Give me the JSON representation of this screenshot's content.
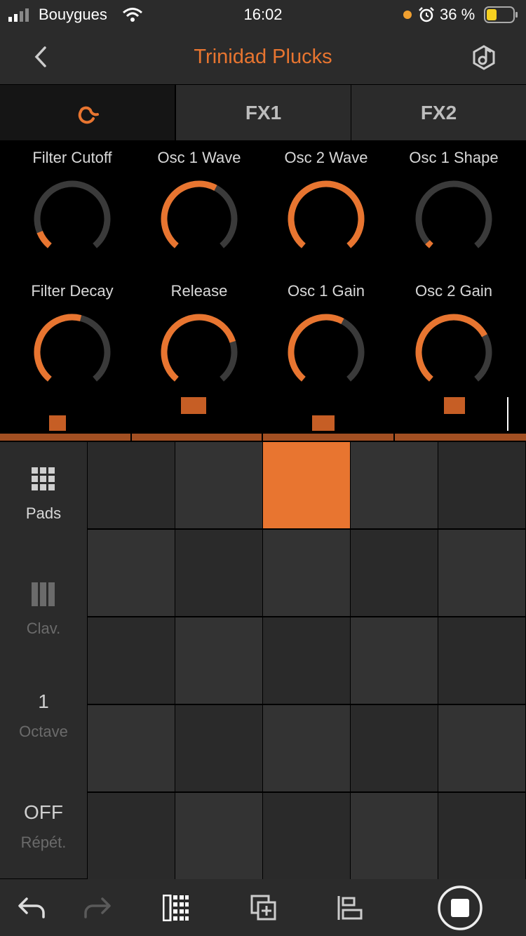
{
  "status_bar": {
    "carrier": "Bouygues",
    "time": "16:02",
    "battery": "36 %"
  },
  "header": {
    "title": "Trinidad Plucks",
    "back_icon": "chevron-left-icon",
    "action_icon": "browser-icon"
  },
  "tabs": [
    {
      "label": "",
      "icon": "wave-icon",
      "active": true
    },
    {
      "label": "FX1",
      "active": false
    },
    {
      "label": "FX2",
      "active": false
    }
  ],
  "knobs": [
    {
      "label": "Filter Cutoff",
      "value": 0.1
    },
    {
      "label": "Osc 1 Wave",
      "value": 0.6
    },
    {
      "label": "Osc 2 Wave",
      "value": 1.0
    },
    {
      "label": "Osc 1 Shape",
      "value": 0.03
    },
    {
      "label": "Filter Decay",
      "value": 0.55
    },
    {
      "label": "Release",
      "value": 0.76
    },
    {
      "label": "Osc 1 Gain",
      "value": 0.6
    },
    {
      "label": "Osc 2 Gain",
      "value": 0.72
    }
  ],
  "level_meters": [
    0.3,
    0.9,
    0.3,
    0.9
  ],
  "side_panel": {
    "pads_label": "Pads",
    "clav_label": "Clav.",
    "octave_value": "1",
    "octave_label": "Octave",
    "repeat_value": "OFF",
    "repeat_label": "Répét."
  },
  "pads": {
    "rows": 5,
    "cols": 5,
    "active": [
      [
        0,
        2
      ]
    ]
  },
  "colors": {
    "accent": "#e87530",
    "knob_track": "#3a3a3a",
    "panel": "#2b2b2b"
  },
  "bottom_bar": {
    "icons": [
      "undo-icon",
      "redo-icon",
      "pads-view-icon",
      "add-clip-icon",
      "mixer-icon",
      "stop-icon"
    ]
  }
}
